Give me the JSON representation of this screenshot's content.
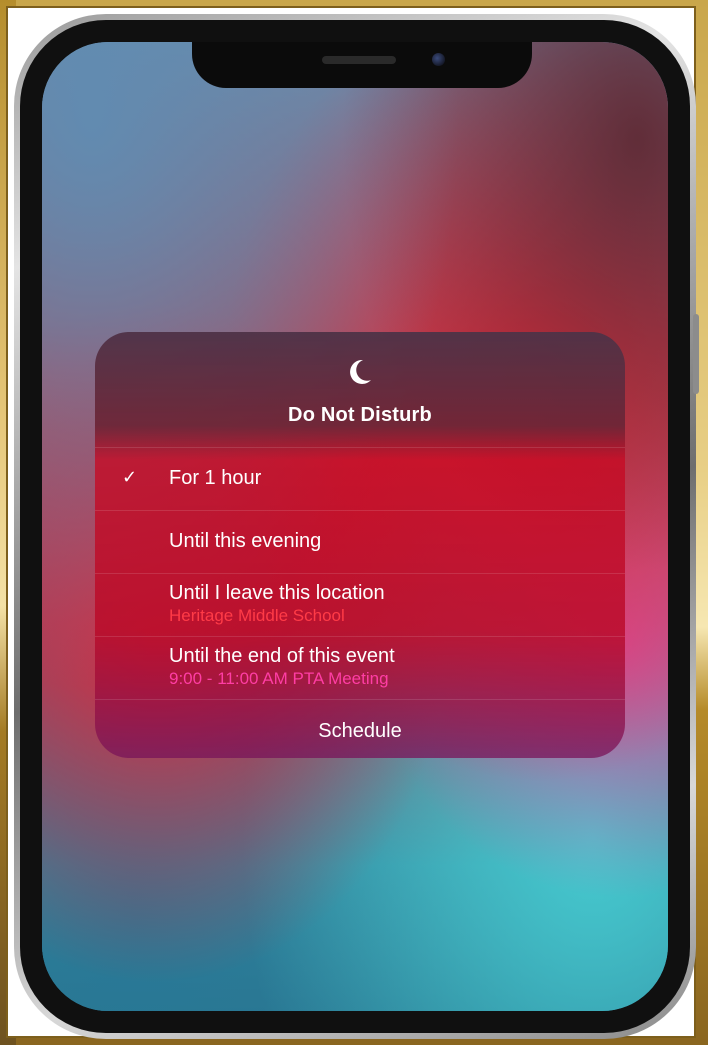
{
  "dnd": {
    "title": "Do Not Disturb",
    "options": [
      {
        "label": "For 1 hour",
        "sublabel": "",
        "checked": true
      },
      {
        "label": "Until this evening",
        "sublabel": "",
        "checked": false
      },
      {
        "label": "Until I leave this location",
        "sublabel": "Heritage Middle School",
        "checked": false
      },
      {
        "label": "Until the end of this event",
        "sublabel": "9:00 - 11:00 AM PTA Meeting",
        "checked": false
      }
    ],
    "check_glyph": "✓",
    "schedule_label": "Schedule"
  },
  "colors": {
    "location_sublabel": "#ff3b47",
    "event_sublabel": "#ff3da4"
  },
  "icons": {
    "moon": "moon-icon",
    "check": "checkmark-icon"
  }
}
